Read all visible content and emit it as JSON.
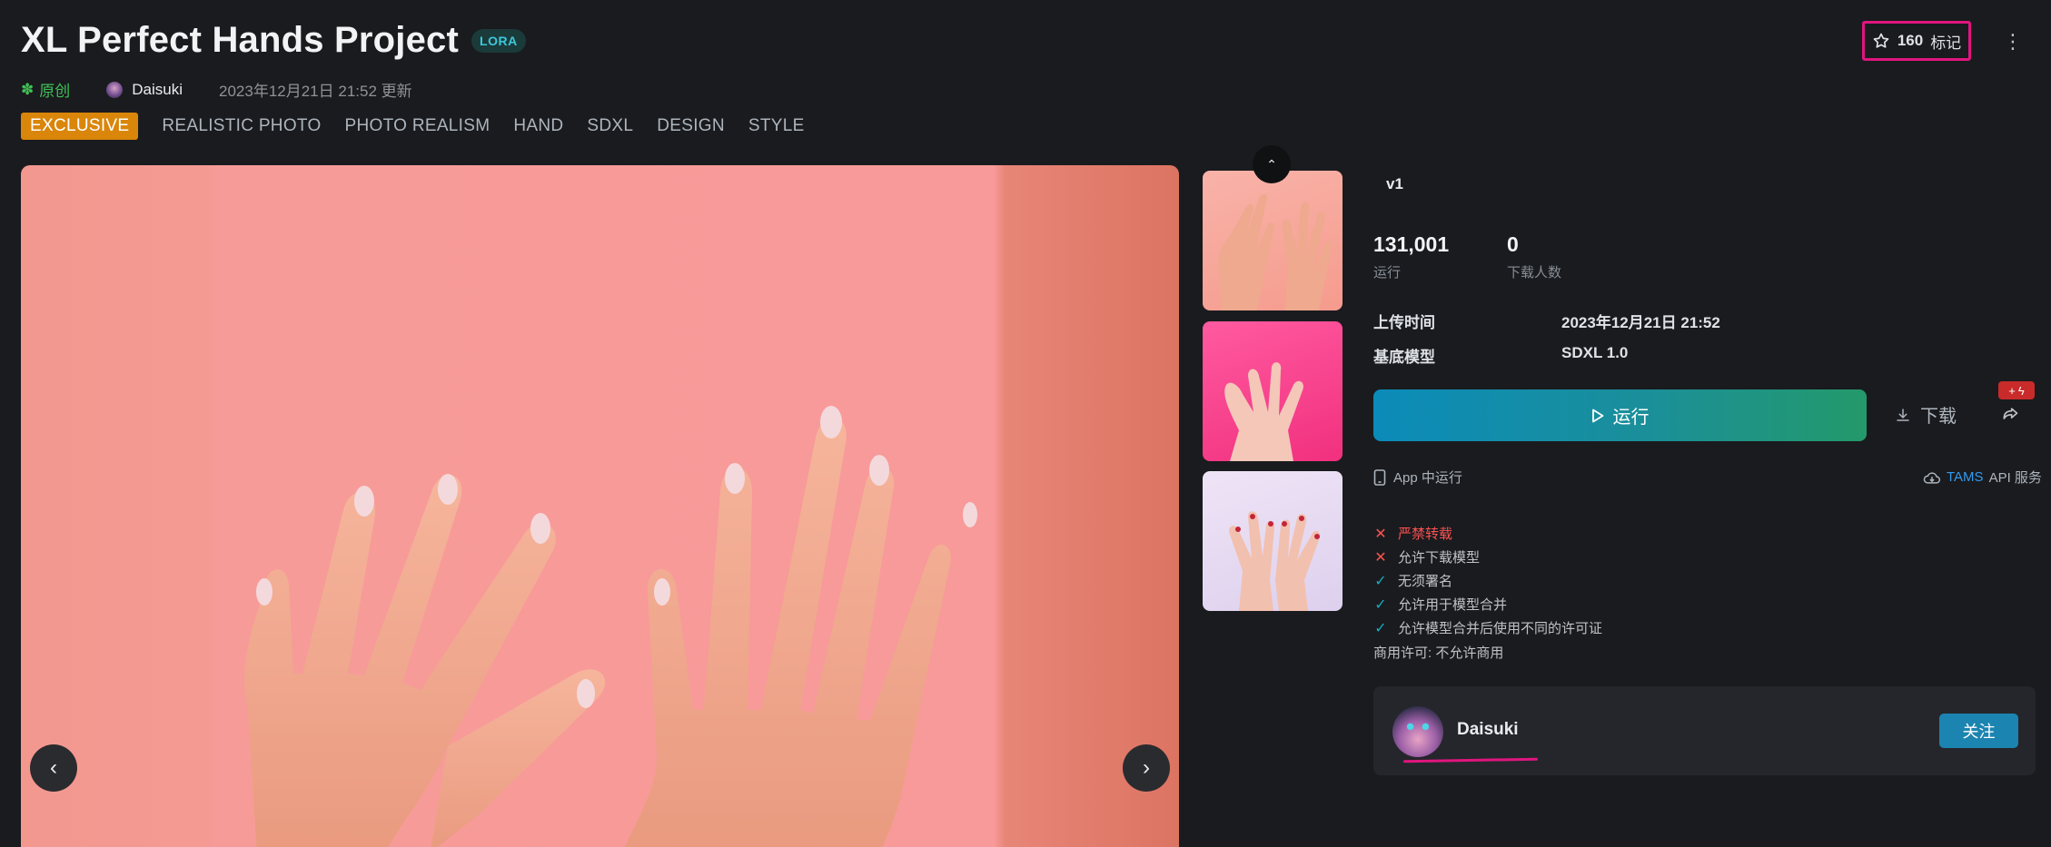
{
  "header": {
    "title": "XL Perfect Hands Project",
    "type_badge": "LORA",
    "original_label": "原创",
    "author": "Daisuki",
    "updated": "2023年12月21日 21:52 更新",
    "favorites_count": "160",
    "favorites_label": "标记"
  },
  "tags": [
    "EXCLUSIVE",
    "REALISTIC PHOTO",
    "PHOTO REALISM",
    "HAND",
    "SDXL",
    "DESIGN",
    "STYLE"
  ],
  "gallery": {
    "prev_label": "‹",
    "next_label": "›",
    "collapse_label": "⌃",
    "thumbnail_count": 3
  },
  "version": {
    "name": "v1"
  },
  "stats": {
    "runs_value": "131,001",
    "runs_label": "运行",
    "downloads_value": "0",
    "downloads_label": "下载人数"
  },
  "info": {
    "upload_time_label": "上传时间",
    "upload_time_value": "2023年12月21日 21:52",
    "base_model_label": "基底模型",
    "base_model_value": "SDXL 1.0"
  },
  "actions": {
    "run_label": "运行",
    "download_label": "下载",
    "app_run_label": "App 中运行",
    "api_brand": "TAMS",
    "api_label": "API 服务"
  },
  "permissions": [
    {
      "text": "严禁转载",
      "allowed": false
    },
    {
      "text": "允许下载模型",
      "allowed": false
    },
    {
      "text": "无须署名",
      "allowed": true
    },
    {
      "text": "允许用于模型合并",
      "allowed": true
    },
    {
      "text": "允许模型合并后使用不同的许可证",
      "allowed": true
    }
  ],
  "commercial": "商用许可: 不允许商用",
  "author_card": {
    "name": "Daisuki",
    "follow_label": "关注"
  },
  "colors": {
    "accent_pink": "#e0157f",
    "exclusive_orange": "#d9860b",
    "run_gradient_start": "#0b8bb9",
    "run_gradient_end": "#24996a",
    "original_green": "#40c057"
  }
}
